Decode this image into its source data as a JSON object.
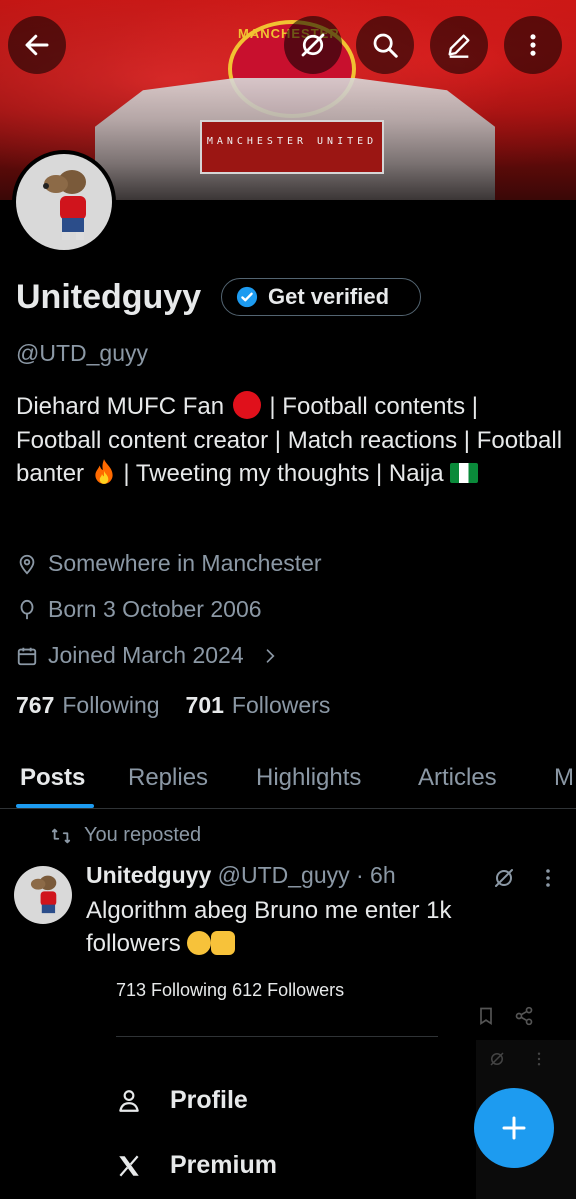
{
  "banner": {
    "crest_text": "MANCHESTER",
    "stand_text": "MANCHESTER UNITED"
  },
  "top_bar": {
    "back": "back-arrow-icon",
    "grok": "grok-icon",
    "search": "search-icon",
    "edit": "edit-icon",
    "more": "more-vertical-icon"
  },
  "profile": {
    "name": "Unitedguyy",
    "verify_label": "Get verified",
    "handle": "@UTD_guyy",
    "bio_1": "Diehard MUFC Fan",
    "bio_2": "| Football contents | Football content creator | Match reactions | Football banter",
    "bio_3": "| Tweeting my thoughts | Naija",
    "location": "Somewhere in Manchester",
    "birthday": "Born 3 October 2006",
    "joined": "Joined March 2024",
    "following_count": "767",
    "following_label": "Following",
    "followers_count": "701",
    "followers_label": "Followers"
  },
  "tabs": [
    "Posts",
    "Replies",
    "Highlights",
    "Articles",
    "M"
  ],
  "post": {
    "repost_label": "You reposted",
    "author": "Unitedguyy",
    "meta": "@UTD_guyy · 6h",
    "text": "Algorithm abeg Bruno me enter 1k followers",
    "sub_stats": "713 Following  612 Followers"
  },
  "drawer": {
    "items": [
      {
        "label": "Profile",
        "icon": "person-icon"
      },
      {
        "label": "Premium",
        "icon": "x-logo-icon"
      }
    ]
  },
  "colors": {
    "accent": "#1d9bf0",
    "background": "#000000",
    "muted": "#8b98a5"
  }
}
